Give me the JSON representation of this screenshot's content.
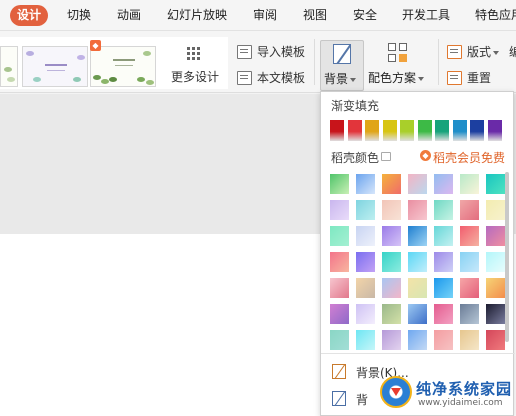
{
  "tabs": [
    {
      "label": "设计",
      "active": true
    },
    {
      "label": "切换"
    },
    {
      "label": "动画"
    },
    {
      "label": "幻灯片放映"
    },
    {
      "label": "审阅"
    },
    {
      "label": "视图"
    },
    {
      "label": "安全"
    },
    {
      "label": "开发工具"
    },
    {
      "label": "特色应用"
    }
  ],
  "ribbon": {
    "more_design": "更多设计",
    "import_template": "导入模板",
    "text_template": "本文模板",
    "background": "背景",
    "color_scheme": "配色方案",
    "layout": "版式",
    "reset": "重置",
    "cut_label": "编"
  },
  "panel": {
    "gradient_title": "渐变填充",
    "shell_colors_title": "稻壳颜色",
    "member_free": "稻壳会员免费",
    "menu_background": "背景(K)...",
    "menu_partial": "背"
  },
  "gradient_colors": [
    "#c8141a",
    "#e2353b",
    "#e0a518",
    "#d8c512",
    "#a9cf2a",
    "#3dba46",
    "#17a37b",
    "#1f8ec9",
    "#1c3fa0",
    "#6a2aa8"
  ],
  "swatch_rows": [
    [
      [
        "#4fc46a",
        "#c9f0b5"
      ],
      [
        "#6ba4ee",
        "#d6e6fb"
      ],
      [
        "#f5b23c",
        "#f06c6a"
      ],
      [
        "#f3b4c4",
        "#bbd8ee"
      ],
      [
        "#93bdf0",
        "#dcb8f0"
      ],
      [
        "#b8e9c8",
        "#f9f4d9"
      ],
      [
        "#19c5c0",
        "#4fe3c1"
      ]
    ],
    [
      [
        "#c9b6ee",
        "#e9dcfa"
      ],
      [
        "#7fd4e0",
        "#bdeff0"
      ],
      [
        "#f2c5b8",
        "#f8e2d6"
      ],
      [
        "#e98ea1",
        "#f7c7cf"
      ],
      [
        "#6fd8c4",
        "#c6f3e4"
      ],
      [
        "#f0a7a7",
        "#e36d7f"
      ],
      [
        "#f3ecb0",
        "#f7f2cd"
      ]
    ],
    [
      [
        "#7ee8c2",
        "#a4f0d2"
      ],
      [
        "#c8d4f2",
        "#eef1fb"
      ],
      [
        "#9a7be8",
        "#d6c4f7"
      ],
      [
        "#1f7fd0",
        "#9ed4f4"
      ],
      [
        "#66d7d8",
        "#c4f1f1"
      ],
      [
        "#f25d6e",
        "#f5b2a2"
      ],
      [
        "#b56ac0",
        "#f08fa0"
      ]
    ],
    [
      [
        "#f3748a",
        "#f8b6a0"
      ],
      [
        "#7a6ef0",
        "#c3a2f5"
      ],
      [
        "#36d3c8",
        "#8cecdf"
      ],
      [
        "#5bd7f5",
        "#c1eefb"
      ],
      [
        "#9d8ae8",
        "#cfd1f7"
      ],
      [
        "#88d2f3",
        "#c6e8fb"
      ],
      [
        "#b3f6fa",
        "#e8fdfd"
      ]
    ],
    [
      [
        "#f7c6cf",
        "#e2788c"
      ],
      [
        "#f2d4a8",
        "#c9b8a7"
      ],
      [
        "#a9c6f2",
        "#f3b6c8"
      ],
      [
        "#f3e3a8",
        "#d8e6b2"
      ],
      [
        "#1c98ec",
        "#74d3f8"
      ],
      [
        "#f6a6a7",
        "#e45f7a"
      ],
      [
        "#f6d476",
        "#f38d4c"
      ]
    ],
    [
      [
        "#d17fd2",
        "#8f6ac9"
      ],
      [
        "#cec2f4",
        "#f4eefd"
      ],
      [
        "#9ab88a",
        "#d4e1a8"
      ],
      [
        "#9cc9f2",
        "#3e6fc8"
      ],
      [
        "#e45c8f",
        "#f3a1c2"
      ],
      [
        "#6a7c96",
        "#b6c6d6"
      ],
      [
        "#1b1b2f",
        "#7a7d9e"
      ]
    ],
    [
      [
        "#8ad6c5",
        "#a2ded6"
      ],
      [
        "#6ee6f3",
        "#c6f6f9"
      ],
      [
        "#b59ad8",
        "#e3d3ef"
      ],
      [
        "#6fa8f0",
        "#c3d9f5"
      ],
      [
        "#f49da1",
        "#f6c2c3"
      ],
      [
        "#e6c68e",
        "#f5e6c8"
      ],
      [
        "#d4465a",
        "#f07a7d"
      ]
    ]
  ]
}
